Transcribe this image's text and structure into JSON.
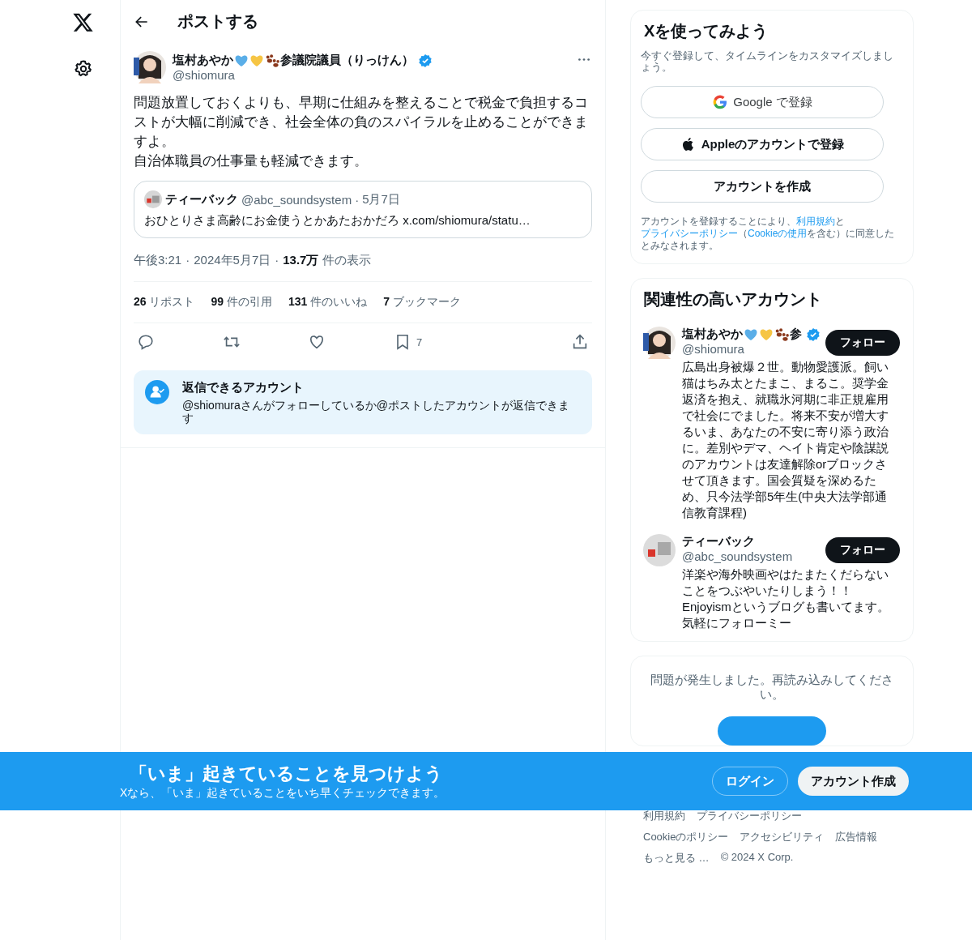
{
  "header": {
    "title": "ポストする"
  },
  "post": {
    "author": {
      "name": "塩村あやか",
      "badges": [
        {
          "kind": "heart",
          "color": "#5aaee8"
        },
        {
          "kind": "heart",
          "color": "#f6c544"
        },
        {
          "kind": "paw",
          "color": "#8b3a1e"
        }
      ],
      "title": "参議院議員（りっけん）",
      "handle": "@shiomura",
      "verified": true
    },
    "paragraphs": [
      "問題放置しておくよりも、早期に仕組みを整えることで税金で負担するコストが大幅に削減でき、社会全体の負のスパイラルを止めることができますよ。",
      "自治体職員の仕事量も軽減できます。"
    ],
    "quote": {
      "name": "ティーバック",
      "handle": "@abc_soundsystem",
      "separator": "·",
      "date": "5月7日",
      "text": "おひとりさま高齢にお金使うとかあたおかだろ x.com/shiomura/statu…"
    },
    "meta": {
      "time": "午後3:21",
      "separator_1": "·",
      "date": "2024年5月7日",
      "separator_2": "·",
      "views": "13.7万",
      "views_label": "件の表示"
    },
    "stats": [
      {
        "count": "26",
        "label": "リポスト"
      },
      {
        "count": "99",
        "label": "件の引用"
      },
      {
        "count": "131",
        "label": "件のいいね"
      },
      {
        "count": "7",
        "label": "ブックマーク"
      }
    ],
    "actions": [
      {
        "kind": "reply"
      },
      {
        "kind": "repost"
      },
      {
        "kind": "like"
      },
      {
        "kind": "bookmark",
        "count": "7"
      },
      {
        "kind": "share"
      }
    ],
    "reply_notice": {
      "title": "返信できるアカウント",
      "text": "@shiomuraさんがフォローしているか@ポストしたアカウントが返信できます"
    }
  },
  "signup": {
    "title": "Xを使ってみよう",
    "subtitle": "今すぐ登録して、タイムラインをカスタマイズしましょう。",
    "buttons": [
      {
        "kind": "google",
        "label": "Google で登録"
      },
      {
        "kind": "apple",
        "label": "Appleのアカウントで登録"
      },
      {
        "kind": "create",
        "label": "アカウントを作成"
      }
    ],
    "terms": [
      {
        "text": "アカウントを登録することにより、",
        "link": false
      },
      {
        "text": "利用規約",
        "link": true
      },
      {
        "text": "と",
        "link": false
      },
      {
        "text": "プライバシーポリシー",
        "link": true
      },
      {
        "text": "（",
        "link": false
      },
      {
        "text": "Cookieの使用",
        "link": true
      },
      {
        "text": "を含む）に同意したとみなされます。",
        "link": false
      }
    ]
  },
  "suggestions": {
    "title": "関連性の高いアカウント",
    "accounts": [
      {
        "name": "塩村あやか",
        "badges": [
          {
            "kind": "heart",
            "color": "#5aaee8"
          },
          {
            "kind": "heart",
            "color": "#f6c544"
          },
          {
            "kind": "paw",
            "color": "#8b3a1e"
          }
        ],
        "title": "参",
        "verified": true,
        "handle": "@shiomura",
        "button": "フォロー",
        "bio": "広島出身被爆２世。動物愛護派。飼い猫はちみ太とたまこ、まるこ。奨学金返済を抱え、就職氷河期に非正規雇用で社会にでました。将来不安が増大するいま、あなたの不安に寄り添う政治に。差別やデマ、ヘイト肯定や陰謀説のアカウントは友達解除orブロックさせて頂きます。国会質疑を深めるため、只今法学部5年生(中央大法学部通信教育課程)"
      },
      {
        "name": "ティーバック",
        "verified": false,
        "handle": "@abc_soundsystem",
        "button": "フォロー",
        "bio": "洋楽や海外映画やはたまたくだらないことをつぶやいたりしまう！！Enjoyismというブログも書いてます。気軽にフォローミー"
      }
    ]
  },
  "error_card": {
    "message": "問題が発生しました。再読み込みしてください。"
  },
  "footer": {
    "rows": [
      [
        "利用規約",
        "プライバシーポリシー"
      ],
      [
        "Cookieのポリシー",
        "アクセシビリティ",
        "広告情報"
      ],
      [
        "もっと見る …",
        "© 2024 X Corp."
      ]
    ]
  },
  "banner": {
    "title": "「いま」起きていることを見つけよう",
    "subtitle": "Xなら、「いま」起きていることをいち早くチェックできます。",
    "login": "ログイン",
    "signup": "アカウント作成"
  }
}
